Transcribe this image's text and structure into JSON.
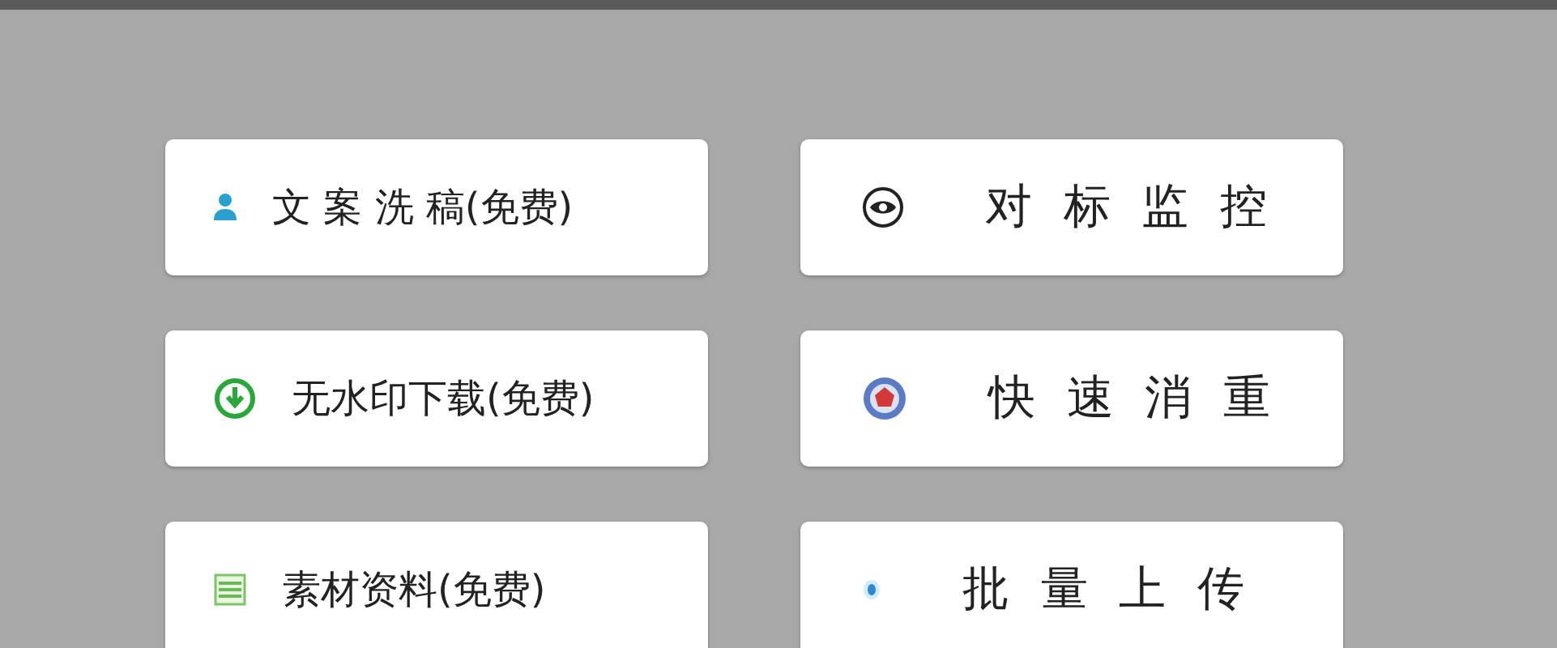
{
  "columns": [
    {
      "buttons": [
        {
          "label": "文 案 洗 稿(免费)"
        },
        {
          "label": "无水印下载(免费)"
        },
        {
          "label": "素材资料(免费)"
        }
      ]
    },
    {
      "buttons": [
        {
          "label": "对 标 监 控"
        },
        {
          "label": "快 速 消 重"
        },
        {
          "label": "批 量 上 传"
        }
      ]
    }
  ]
}
